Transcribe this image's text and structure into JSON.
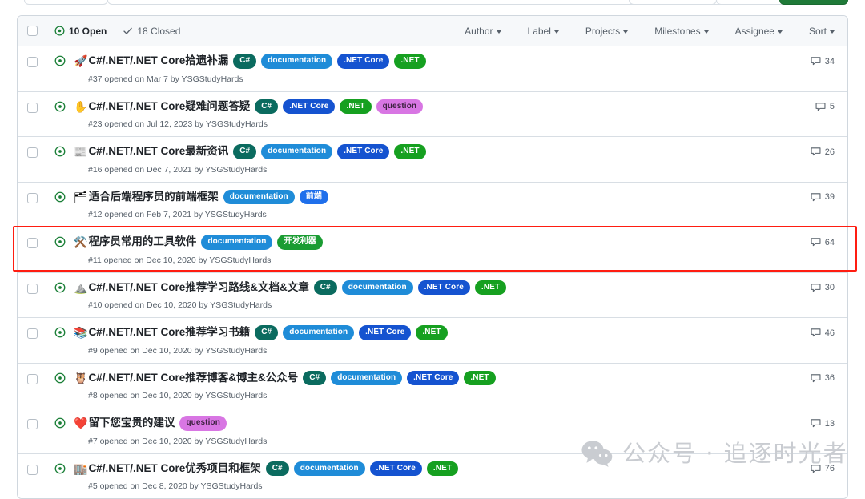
{
  "toolbar": {
    "new_issue_label": ""
  },
  "list_header": {
    "select_all_checkbox": "",
    "open_icon": "issue-opened-icon",
    "open_count_label": "10 Open",
    "closed_icon": "check-icon",
    "closed_count_label": "18 Closed",
    "filters": [
      {
        "label": "Author",
        "name": "filter-author"
      },
      {
        "label": "Label",
        "name": "filter-label"
      },
      {
        "label": "Projects",
        "name": "filter-projects"
      },
      {
        "label": "Milestones",
        "name": "filter-milestones"
      },
      {
        "label": "Assignee",
        "name": "filter-assignee"
      },
      {
        "label": "Sort",
        "name": "filter-sort"
      }
    ]
  },
  "label_colors": {
    "csharp": "#0b6b5f",
    "documentation": "#1f8cd8",
    "dotnet_core": "#1553d0",
    "dotnet": "#16a020",
    "question": "#d876e3",
    "frontend": "#1f6feb",
    "dev_tools": "#1a9c32"
  },
  "issues": [
    {
      "emoji": "🚀",
      "emoji_name": "rocket-emoji",
      "title": "C#/.NET/.NET Core拾遗补漏",
      "labels": [
        {
          "text": "C#",
          "color": "#0b6b5f",
          "text_color": "#ffffff"
        },
        {
          "text": "documentation",
          "color": "#1f8cd8",
          "text_color": "#ffffff"
        },
        {
          "text": ".NET Core",
          "color": "#1553d0",
          "text_color": "#ffffff"
        },
        {
          "text": ".NET",
          "color": "#16a020",
          "text_color": "#ffffff"
        }
      ],
      "meta": "#37 opened on Mar 7 by YSGStudyHards",
      "comments": "34"
    },
    {
      "emoji": "✋",
      "emoji_name": "raised-hand-emoji",
      "title": "C#/.NET/.NET Core疑难问题答疑",
      "labels": [
        {
          "text": "C#",
          "color": "#0b6b5f",
          "text_color": "#ffffff"
        },
        {
          "text": ".NET Core",
          "color": "#1553d0",
          "text_color": "#ffffff"
        },
        {
          "text": ".NET",
          "color": "#16a020",
          "text_color": "#ffffff"
        },
        {
          "text": "question",
          "color": "#d876e3",
          "text_color": "#3d2140"
        }
      ],
      "meta": "#23 opened on Jul 12, 2023 by YSGStudyHards",
      "comments": "5"
    },
    {
      "emoji": "📰",
      "emoji_name": "newspaper-emoji",
      "title": "C#/.NET/.NET Core最新资讯",
      "labels": [
        {
          "text": "C#",
          "color": "#0b6b5f",
          "text_color": "#ffffff"
        },
        {
          "text": "documentation",
          "color": "#1f8cd8",
          "text_color": "#ffffff"
        },
        {
          "text": ".NET Core",
          "color": "#1553d0",
          "text_color": "#ffffff"
        },
        {
          "text": ".NET",
          "color": "#16a020",
          "text_color": "#ffffff"
        }
      ],
      "meta": "#16 opened on Dec 7, 2021 by YSGStudyHards",
      "comments": "26"
    },
    {
      "emoji": "🗂",
      "emoji_name": "card-index-dividers-emoji",
      "title": "适合后端程序员的前端框架",
      "labels": [
        {
          "text": "documentation",
          "color": "#1f8cd8",
          "text_color": "#ffffff"
        },
        {
          "text": "前端",
          "color": "#1f6feb",
          "text_color": "#ffffff"
        }
      ],
      "meta": "#12 opened on Feb 7, 2021 by YSGStudyHards",
      "comments": "39"
    },
    {
      "emoji": "⚒️",
      "emoji_name": "hammer-and-pick-emoji",
      "title": "程序员常用的工具软件",
      "labels": [
        {
          "text": "documentation",
          "color": "#1f8cd8",
          "text_color": "#ffffff"
        },
        {
          "text": "开发利器",
          "color": "#1a9c32",
          "text_color": "#ffffff"
        }
      ],
      "meta": "#11 opened on Dec 10, 2020 by YSGStudyHards",
      "comments": "64"
    },
    {
      "emoji": "⛰️",
      "emoji_name": "mountain-emoji",
      "title": "C#/.NET/.NET Core推荐学习路线&文档&文章",
      "labels": [
        {
          "text": "C#",
          "color": "#0b6b5f",
          "text_color": "#ffffff"
        },
        {
          "text": "documentation",
          "color": "#1f8cd8",
          "text_color": "#ffffff"
        },
        {
          "text": ".NET Core",
          "color": "#1553d0",
          "text_color": "#ffffff"
        },
        {
          "text": ".NET",
          "color": "#16a020",
          "text_color": "#ffffff"
        }
      ],
      "meta": "#10 opened on Dec 10, 2020 by YSGStudyHards",
      "comments": "30"
    },
    {
      "emoji": "📚",
      "emoji_name": "books-emoji",
      "title": "C#/.NET/.NET Core推荐学习书籍",
      "labels": [
        {
          "text": "C#",
          "color": "#0b6b5f",
          "text_color": "#ffffff"
        },
        {
          "text": "documentation",
          "color": "#1f8cd8",
          "text_color": "#ffffff"
        },
        {
          "text": ".NET Core",
          "color": "#1553d0",
          "text_color": "#ffffff"
        },
        {
          "text": ".NET",
          "color": "#16a020",
          "text_color": "#ffffff"
        }
      ],
      "meta": "#9 opened on Dec 10, 2020 by YSGStudyHards",
      "comments": "46"
    },
    {
      "emoji": "🦉",
      "emoji_name": "owl-emoji",
      "title": "C#/.NET/.NET Core推荐博客&博主&公众号",
      "labels": [
        {
          "text": "C#",
          "color": "#0b6b5f",
          "text_color": "#ffffff"
        },
        {
          "text": "documentation",
          "color": "#1f8cd8",
          "text_color": "#ffffff"
        },
        {
          "text": ".NET Core",
          "color": "#1553d0",
          "text_color": "#ffffff"
        },
        {
          "text": ".NET",
          "color": "#16a020",
          "text_color": "#ffffff"
        }
      ],
      "meta": "#8 opened on Dec 10, 2020 by YSGStudyHards",
      "comments": "36"
    },
    {
      "emoji": "❤️",
      "emoji_name": "heart-emoji",
      "title": "留下您宝贵的建议",
      "labels": [
        {
          "text": "question",
          "color": "#d876e3",
          "text_color": "#3d2140"
        }
      ],
      "meta": "#7 opened on Dec 10, 2020 by YSGStudyHards",
      "comments": "13"
    },
    {
      "emoji": "🏬",
      "emoji_name": "department-store-emoji",
      "title": "C#/.NET/.NET Core优秀项目和框架",
      "labels": [
        {
          "text": "C#",
          "color": "#0b6b5f",
          "text_color": "#ffffff"
        },
        {
          "text": "documentation",
          "color": "#1f8cd8",
          "text_color": "#ffffff"
        },
        {
          "text": ".NET Core",
          "color": "#1553d0",
          "text_color": "#ffffff"
        },
        {
          "text": ".NET",
          "color": "#16a020",
          "text_color": "#ffffff"
        }
      ],
      "meta": "#5 opened on Dec 8, 2020 by YSGStudyHards",
      "comments": "76"
    }
  ],
  "watermark": {
    "text": "公众号 · 追逐时光者",
    "logo": "wechat-logo"
  },
  "annotation": {
    "highlight_color": "#ff1d11"
  }
}
